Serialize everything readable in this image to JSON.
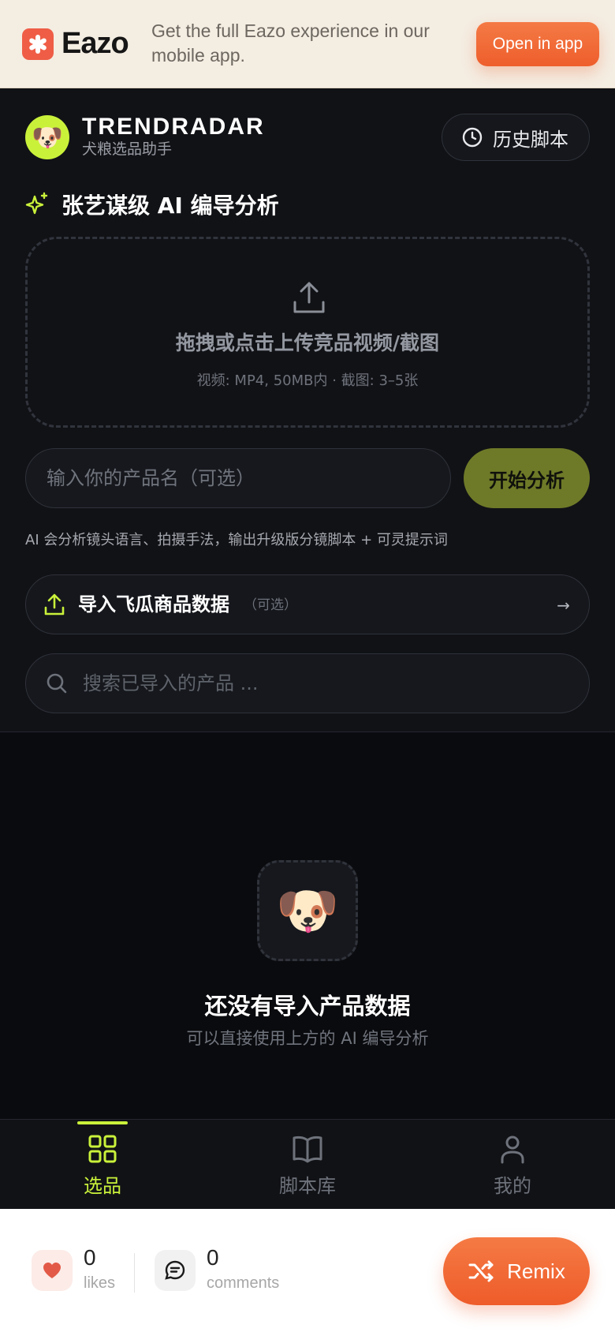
{
  "promo": {
    "brand": "Eazo",
    "message": "Get the full Eazo experience in our mobile app.",
    "open_label": "Open in app"
  },
  "header": {
    "avatar_emoji": "🐶",
    "title": "TRENDRADAR",
    "subtitle": "犬粮选品助手",
    "history_label": "历史脚本"
  },
  "analysis": {
    "section_title": "张艺谋级 AI 编导分析",
    "upload_main": "拖拽或点击上传竞品视频/截图",
    "upload_hint": "视频: MP4, 50MB内  ·  截图: 3–5张",
    "product_placeholder": "输入你的产品名（可选）",
    "start_label": "开始分析",
    "note": "AI 会分析镜头语言、拍摄手法，输出升级版分镜脚本 + 可灵提示词"
  },
  "import": {
    "label": "导入飞瓜商品数据",
    "optional": "（可选）",
    "arrow": "→"
  },
  "search": {
    "placeholder": "搜索已导入的产品 ..."
  },
  "empty": {
    "emoji": "🐶",
    "title": "还没有导入产品数据",
    "subtitle": "可以直接使用上方的 AI 编导分析"
  },
  "tabs": [
    {
      "label": "选品",
      "icon": "grid-icon",
      "active": true
    },
    {
      "label": "脚本库",
      "icon": "book-icon",
      "active": false
    },
    {
      "label": "我的",
      "icon": "user-icon",
      "active": false
    }
  ],
  "engagement": {
    "likes_count": "0",
    "likes_label": "likes",
    "comments_count": "0",
    "comments_label": "comments",
    "remix_label": "Remix"
  },
  "colors": {
    "accent_lime": "#c9f13a",
    "start_button": "#6f7a28",
    "brand_orange": "#ee5e2c",
    "background": "#0a0b0e"
  }
}
